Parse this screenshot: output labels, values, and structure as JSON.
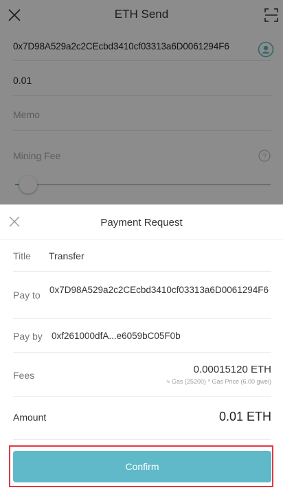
{
  "screen": {
    "title": "ETH Send",
    "close_icon": "close-icon",
    "scan_icon": "scan-icon"
  },
  "form": {
    "address": "0x7D98A529a2c2CEcbd3410cf03313a6D0061294F6",
    "contact_icon": "contact-icon",
    "amount": "0.01",
    "memo_placeholder": "Memo",
    "fee_label": "Mining Fee",
    "help_icon": "help-icon",
    "fee_slider_fraction": 0.05
  },
  "payment_request": {
    "title": "Payment Request",
    "title_label": "Title",
    "title_value": "Transfer",
    "pay_to_label": "Pay to",
    "pay_to_value": "0x7D98A529a2c2CEcbd3410cf03313a6D0061294F6",
    "pay_by_label": "Pay by",
    "pay_by_value": "0xf261000dfA...e6059bC05F0b",
    "fees_label": "Fees",
    "fees_value": "0.00015120 ETH",
    "fees_detail": "≈ Gas (25200) * Gas Price (6.00 gwei)",
    "amount_label": "Amount",
    "amount_value": "0.01 ETH",
    "confirm_label": "Confirm"
  },
  "colors": {
    "accent": "#5fb9c8",
    "highlight_frame": "#e0393e"
  }
}
